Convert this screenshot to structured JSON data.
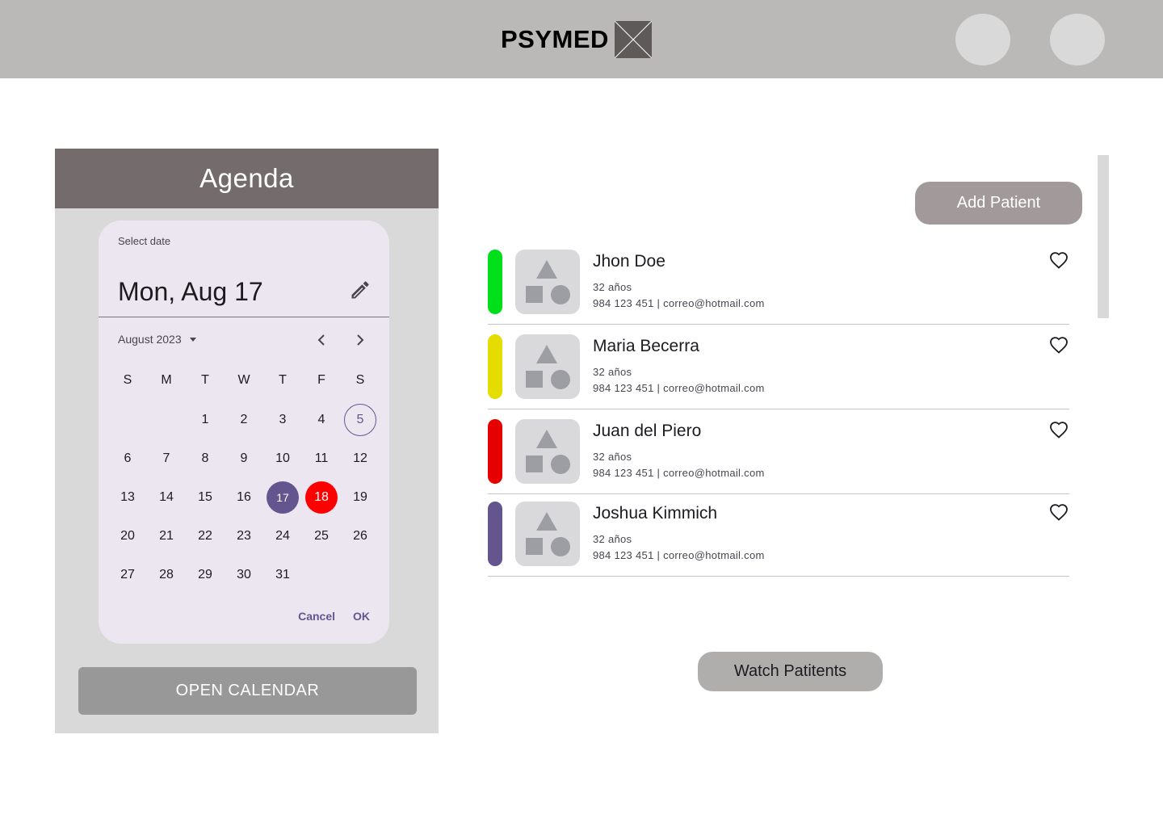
{
  "header": {
    "brand": "PSYMED",
    "brand_logo": "image-placeholder-icon",
    "avatars": [
      "user-avatar",
      "user-avatar"
    ]
  },
  "agenda": {
    "title": "Agenda",
    "picker": {
      "label": "Select date",
      "selected_date": "Mon, Aug 17",
      "month": "August 2023",
      "weekdays": [
        "S",
        "M",
        "T",
        "W",
        "T",
        "F",
        "S"
      ],
      "leading_blanks": 2,
      "days": [
        "1",
        "2",
        "3",
        "4",
        "5",
        "6",
        "7",
        "8",
        "9",
        "10",
        "11",
        "12",
        "13",
        "14",
        "15",
        "16",
        "17",
        "18",
        "19",
        "20",
        "21",
        "22",
        "23",
        "24",
        "25",
        "26",
        "27",
        "28",
        "29",
        "30",
        "31"
      ],
      "today": "5",
      "selected_day": "17",
      "marked_day": "18",
      "cancel_label": "Cancel",
      "ok_label": "OK"
    },
    "open_calendar_label": "OPEN CALENDAR"
  },
  "patients_section": {
    "add_patient_label": "Add Patient",
    "watch_label": "Watch Patitents",
    "patients": [
      {
        "name": "Jhon Doe",
        "age": "32 años",
        "contact": "984 123 451  |  correo@hotmail.com",
        "color": "#00e01a"
      },
      {
        "name": "Maria Becerra",
        "age": "32 años",
        "contact": "984 123 451  |  correo@hotmail.com",
        "color": "#e6dd00"
      },
      {
        "name": "Juan del Piero",
        "age": "32 años",
        "contact": "984 123 451  |  correo@hotmail.com",
        "color": "#e60000"
      },
      {
        "name": "Joshua Kimmich",
        "age": "32 años",
        "contact": "984 123 451  |  correo@hotmail.com",
        "color": "#65558f"
      }
    ]
  },
  "colors": {
    "accent": "#65558f",
    "marked": "#ff0000",
    "header_bg": "#bab9b7",
    "agenda_header": "#746c6c"
  }
}
